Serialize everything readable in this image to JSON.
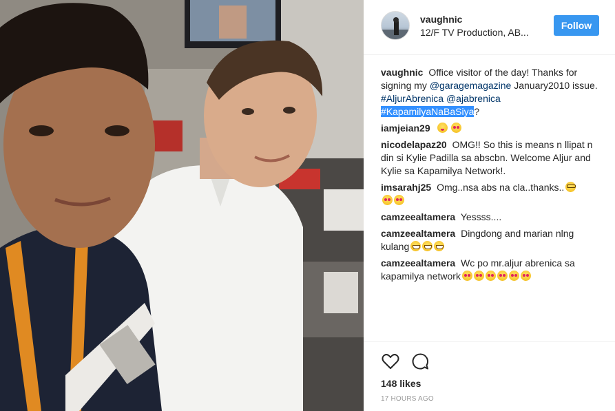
{
  "header": {
    "username": "vaughnic",
    "location": "12/F TV Production, AB...",
    "follow_label": "Follow"
  },
  "caption": {
    "user": "vaughnic",
    "text": "Office visitor of the day! Thanks for signing my",
    "mention_1": "@garagemagazine",
    "text_2": "January2010 issue.",
    "hashtag_1": "#AljurAbrenica",
    "mention_2": "@ajabrenica",
    "hashtag_2": "#KapamilyaNaBaSiya",
    "text_3": "?"
  },
  "comments": [
    {
      "user": "iamjeian29",
      "text": "",
      "emojis": [
        "wink",
        "heart"
      ]
    },
    {
      "user": "nicodelapaz20",
      "text": "OMG!! So this is means n llipat n din si Kylie Padilla sa abscbn. Welcome Aljur and Kylie sa Kapamilya Network!.",
      "emojis": []
    },
    {
      "user": "imsarahj25",
      "text": "Omg..nsa abs na cla..thanks..",
      "emojis": [
        "nerd",
        "heart",
        "heart"
      ]
    },
    {
      "user": "camzeealtamera",
      "text": "Yessss....",
      "emojis": []
    },
    {
      "user": "camzeealtamera",
      "text": "Dingdong and marian nlng kulang",
      "emojis": [
        "grin",
        "grin",
        "grin"
      ]
    },
    {
      "user": "camzeealtamera",
      "text": "Wc po mr.aljur abrenica sa kapamilya network",
      "emojis": [
        "heart",
        "heart",
        "heart",
        "heart",
        "heart",
        "heart"
      ]
    }
  ],
  "footer": {
    "likes": "148 likes",
    "time": "17 HOURS AGO"
  },
  "colors": {
    "follow_bg": "#3897f0",
    "link": "#003569",
    "highlight": "#3390ff"
  },
  "icons": {
    "like": "heart-outline-icon",
    "comment": "speech-bubble-icon"
  }
}
